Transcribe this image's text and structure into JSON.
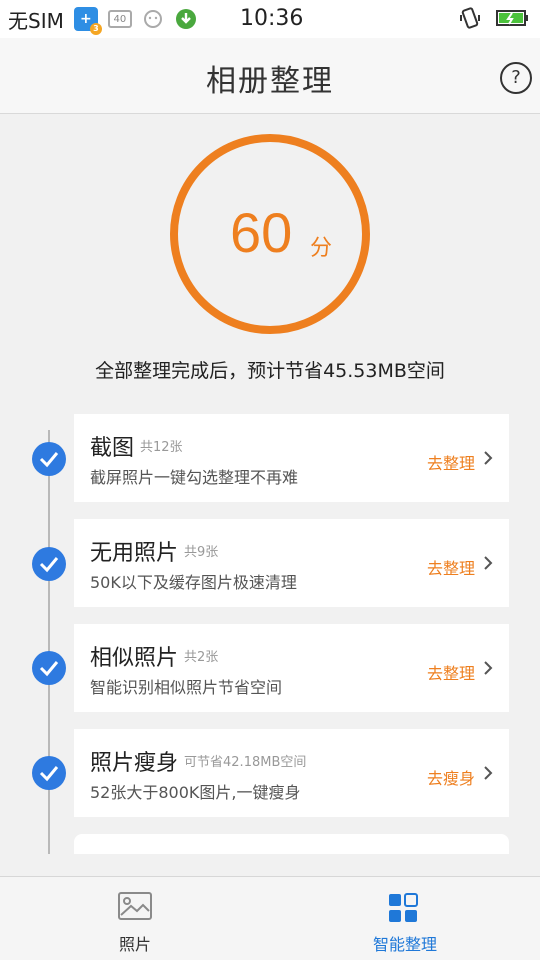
{
  "status_bar": {
    "carrier": "无SIM",
    "net_badge": "+",
    "net_sub": "3",
    "box_label": "40",
    "time": "10:36"
  },
  "header": {
    "title": "相册整理",
    "help_label": "?"
  },
  "score": {
    "value": "60",
    "unit": "分",
    "savings": "全部整理完成后，预计节省45.53MB空间"
  },
  "cards": [
    {
      "title": "截图",
      "count": "共12张",
      "desc": "截屏照片一键勾选整理不再难",
      "action": "去整理"
    },
    {
      "title": "无用照片",
      "count": "共9张",
      "desc": "50K以下及缓存图片极速清理",
      "action": "去整理"
    },
    {
      "title": "相似照片",
      "count": "共2张",
      "desc": "智能识别相似照片节省空间",
      "action": "去整理"
    },
    {
      "title": "照片瘦身",
      "count": "可节省42.18MB空间",
      "desc": "52张大于800K图片,一键瘦身",
      "action": "去瘦身"
    }
  ],
  "bottom_nav": {
    "photos_label": "照片",
    "organize_label": "智能整理"
  },
  "colors": {
    "accent": "#ee7f1f",
    "check": "#2e7ae0",
    "active_tab": "#1f78d8",
    "inactive_tab": "#333333"
  }
}
